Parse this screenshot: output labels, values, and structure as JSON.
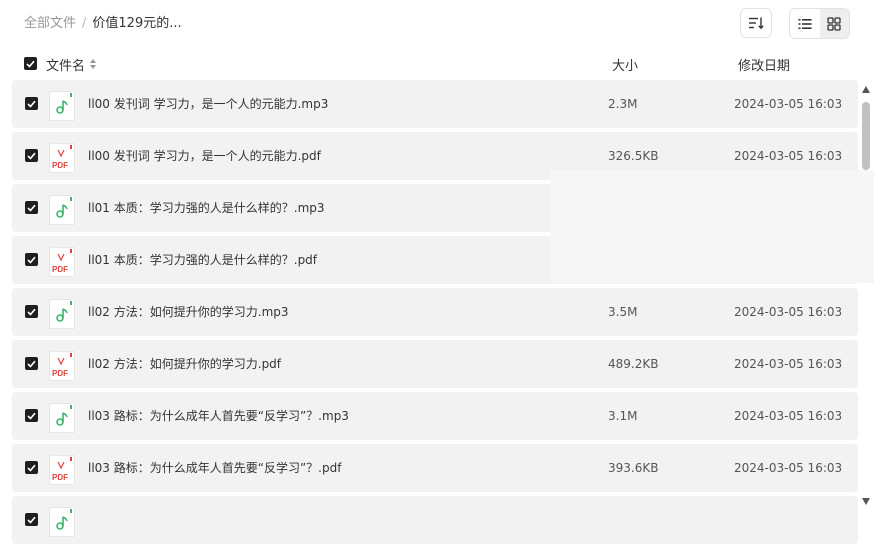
{
  "breadcrumb": {
    "root": "全部文件",
    "separator": "/",
    "current": "价值129元的..."
  },
  "toolbar": {
    "sort_icon": "sort-lines-icon",
    "view_list_icon": "list-view-icon",
    "view_grid_icon": "grid-view-icon",
    "active_view": "grid"
  },
  "header": {
    "name": "文件名",
    "size": "大小",
    "modified": "修改日期"
  },
  "colors": {
    "mp3_icon": "#3db36b",
    "pdf_icon": "#e0443a",
    "row_bg": "#f2f2f2",
    "checkbox": "#1f1f1f"
  },
  "files": [
    {
      "name": "ll00 发刊词 学习力，是一个人的元能力.mp3",
      "type": "mp3",
      "size": "2.3M",
      "modified": "2024-03-05 16:03"
    },
    {
      "name": "ll00 发刊词 学习力，是一个人的元能力.pdf",
      "type": "pdf",
      "size": "326.5KB",
      "modified": "2024-03-05 16:03"
    },
    {
      "name": "ll01 本质：学习力强的人是什么样的？.mp3",
      "type": "mp3",
      "size": "",
      "modified": ""
    },
    {
      "name": "ll01 本质：学习力强的人是什么样的？.pdf",
      "type": "pdf",
      "size": "",
      "modified": ""
    },
    {
      "name": "ll02 方法：如何提升你的学习力.mp3",
      "type": "mp3",
      "size": "3.5M",
      "modified": "2024-03-05 16:03"
    },
    {
      "name": "ll02 方法：如何提升你的学习力.pdf",
      "type": "pdf",
      "size": "489.2KB",
      "modified": "2024-03-05 16:03"
    },
    {
      "name": "ll03 路标：为什么成年人首先要“反学习”？.mp3",
      "type": "mp3",
      "size": "3.1M",
      "modified": "2024-03-05 16:03"
    },
    {
      "name": "ll03 路标：为什么成年人首先要“反学习”？.pdf",
      "type": "pdf",
      "size": "393.6KB",
      "modified": "2024-03-05 16:03"
    },
    {
      "name": "",
      "type": "mp3",
      "size": "",
      "modified": ""
    }
  ]
}
